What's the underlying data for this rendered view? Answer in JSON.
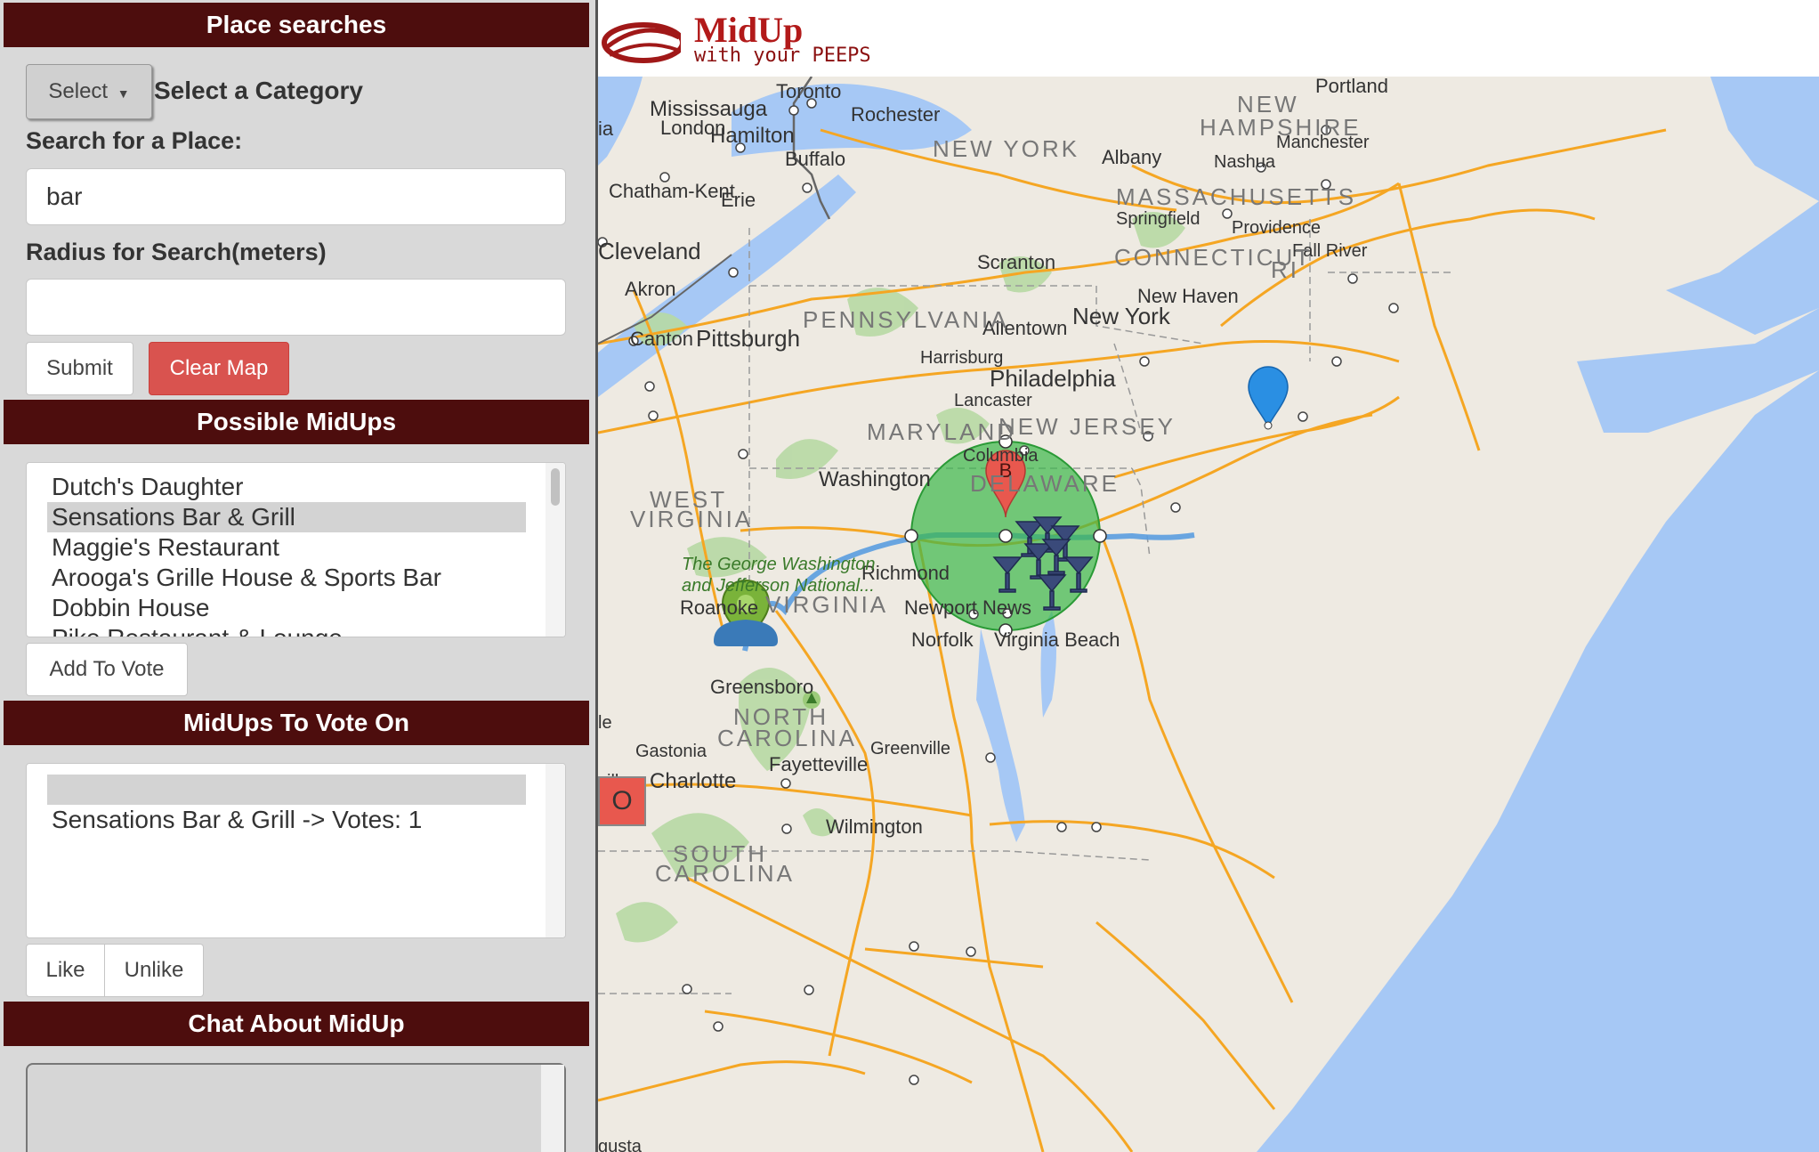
{
  "sidebar": {
    "place_searches": {
      "header": "Place searches",
      "select_button": "Select",
      "category_label": "Select a Category",
      "search_label": "Search for a Place:",
      "search_value": "bar",
      "radius_label": "Radius for Search(meters)",
      "radius_value": "",
      "submit_label": "Submit",
      "clear_label": "Clear Map"
    },
    "possible_midups": {
      "header": "Possible MidUps",
      "items": [
        "Dutch's Daughter",
        "Sensations Bar & Grill",
        "Maggie's Restaurant",
        "Arooga's Grille House & Sports Bar",
        "Dobbin House",
        "Pike Restaurant & Lounge"
      ],
      "selected_index": 1,
      "add_button": "Add To Vote"
    },
    "vote": {
      "header": "MidUps To Vote On",
      "items": [
        "",
        "Sensations Bar & Grill -> Votes: 1"
      ],
      "selected_index": 0,
      "like_button": "Like",
      "unlike_button": "Unlike"
    },
    "chat": {
      "header": "Chat About MidUp"
    }
  },
  "logo": {
    "title": "MidUp",
    "tagline": "with your PEEPS"
  },
  "map": {
    "cities": {
      "toronto": "Toronto",
      "mississauga": "Mississauga",
      "london": "London",
      "hamilton": "Hamilton",
      "buffalo": "Buffalo",
      "rochester": "Rochester",
      "chatham": "Chatham-Kent",
      "erie": "Erie",
      "cleveland": "Cleveland",
      "akron": "Akron",
      "canton": "Canton",
      "pittsburgh": "Pittsburgh",
      "scranton": "Scranton",
      "allentown": "Allentown",
      "harrisburg": "Harrisburg",
      "philadelphia": "Philadelphia",
      "lancaster": "Lancaster",
      "columbia": "Columbia",
      "washington": "Washington",
      "richmond": "Richmond",
      "roanoke": "Roanoke",
      "newport_news": "Newport News",
      "norfolk": "Norfolk",
      "virginia_beach": "Virginia Beach",
      "greensboro": "Greensboro",
      "gastonia": "Gastonia",
      "charlotte": "Charlotte",
      "fayetteville": "Fayetteville",
      "greenville": "Greenville",
      "wilmington": "Wilmington",
      "albany": "Albany",
      "portland": "Portland",
      "nashua": "Nashua",
      "manchester": "Manchester",
      "springfield": "Springfield",
      "providence": "Providence",
      "fall_river": "Fall River",
      "new_haven": "New Haven",
      "new_york": "New York",
      "ia": "ia",
      "ille": "ville",
      "le": "le",
      "gusta": "gusta"
    },
    "states": {
      "new_york": "NEW YORK",
      "new_hampshire_1": "NEW",
      "new_hampshire_2": "HAMPSHIRE",
      "massachusetts": "MASSACHUSETTS",
      "connecticut": "CONNECTICUT",
      "ri": "RI",
      "pennsylvania": "PENNSYLVANIA",
      "new_jersey": "NEW JERSEY",
      "delaware": "DELAWARE",
      "maryland": "MARYLAND",
      "west_virginia_1": "WEST",
      "west_virginia_2": "VIRGINIA",
      "virginia": "VIRGINIA",
      "north_carolina_1": "NORTH",
      "north_carolina_2": "CAROLINA",
      "south_carolina_1": "SOUTH",
      "south_carolina_2": "CAROLINA"
    },
    "park_1": "The George Washington",
    "park_2": "and Jefferson National...",
    "marker_b": "B",
    "side_button": "O",
    "colors": {
      "header": "#4d0d0d",
      "circle": "#3cb84a",
      "route": "#5a9de0",
      "water": "#a6c8f5",
      "clear": "#d9534f"
    }
  }
}
